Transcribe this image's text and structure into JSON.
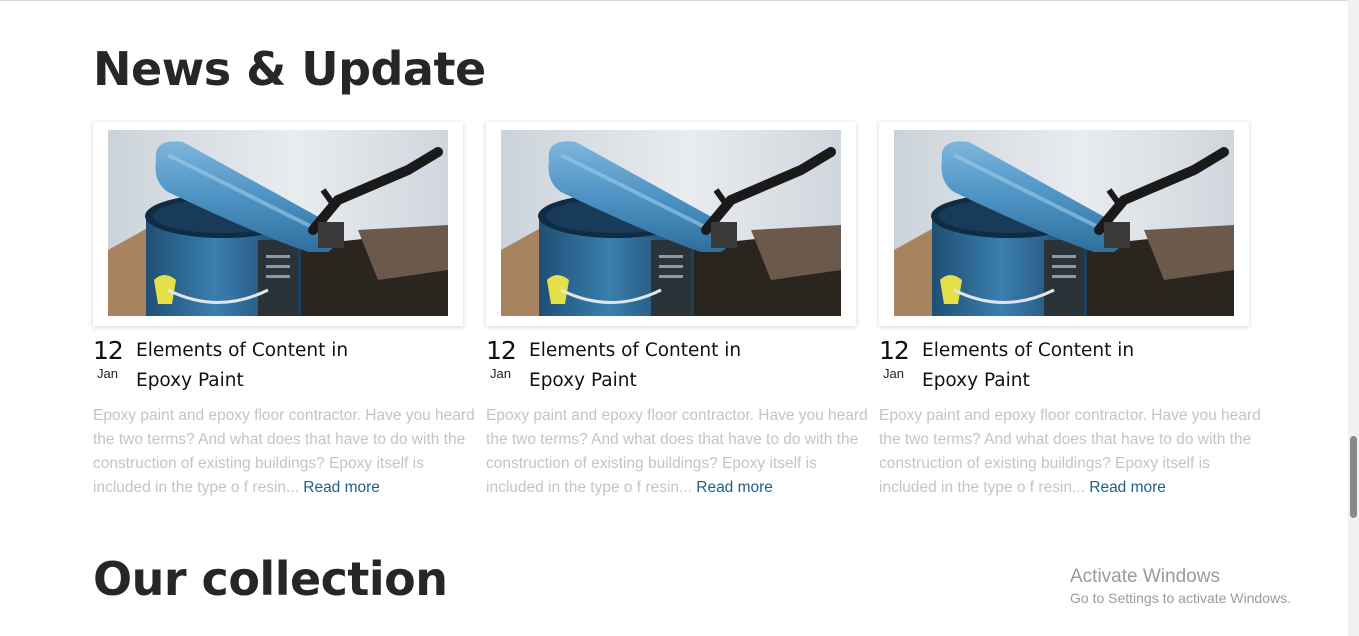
{
  "news": {
    "title": "News & Update",
    "cards": [
      {
        "image": "paint-roller-on-paint-can",
        "day": "12",
        "month": "Jan",
        "title": "Elements of Content in Epoxy Paint",
        "excerpt": "Epoxy paint and epoxy floor contractor. Have you heard the two terms? And what does that have to do with the construction of existing buildings? Epoxy itself is included in the type o f resin...",
        "read_more": "Read more"
      },
      {
        "image": "paint-roller-on-paint-can",
        "day": "12",
        "month": "Jan",
        "title": "Elements of Content in Epoxy Paint",
        "excerpt": "Epoxy paint and epoxy floor contractor. Have you heard the two terms? And what does that have to do with the construction of existing buildings? Epoxy itself is included in the type o f resin...",
        "read_more": "Read more"
      },
      {
        "image": "paint-roller-on-paint-can",
        "day": "12",
        "month": "Jan",
        "title": "Elements of Content in Epoxy Paint",
        "excerpt": "Epoxy paint and epoxy floor contractor. Have you heard the two terms? And what does that have to do with the construction of existing buildings? Epoxy itself is included in the type o f resin...",
        "read_more": "Read more"
      }
    ]
  },
  "collection": {
    "title": "Our collection"
  },
  "watermark": {
    "title": "Activate Windows",
    "subtitle": "Go to Settings to activate Windows."
  },
  "colors": {
    "heading": "#262626",
    "excerpt": "#c4c4c4",
    "link": "#1f5f8f",
    "roller": "#4f95c4",
    "can": "#2f6c96"
  }
}
